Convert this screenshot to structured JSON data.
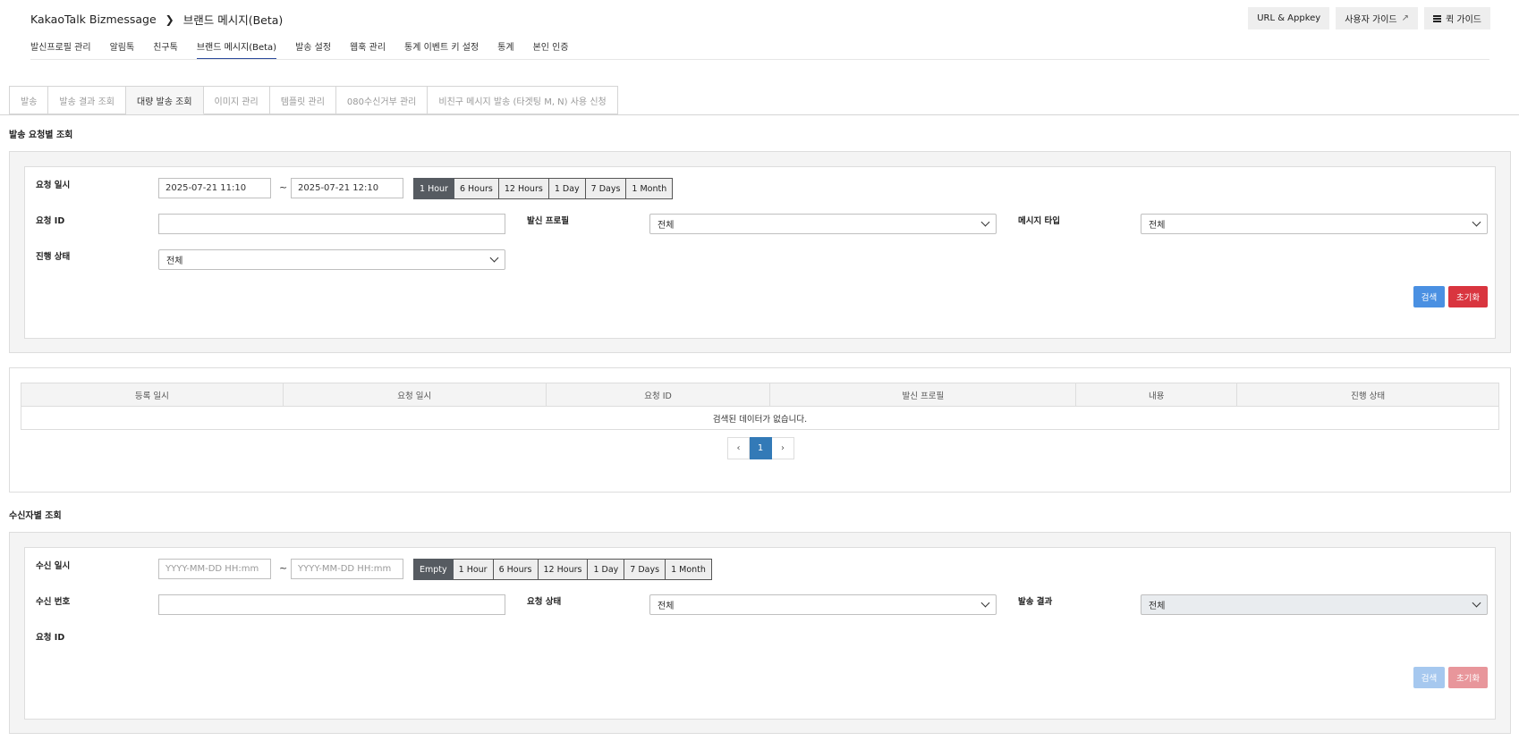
{
  "header": {
    "app_name": "KakaoTalk Bizmessage",
    "breadcrumb_sep": ">",
    "page_name": "브랜드 메시지(Beta)",
    "buttons": {
      "url_appkey": "URL & Appkey",
      "user_guide": "사용자 가이드",
      "quick_guide": "퀵 가이드"
    }
  },
  "nav": {
    "items": [
      "발신프로필 관리",
      "알림톡",
      "친구톡",
      "브랜드 메시지(Beta)",
      "발송 설정",
      "웹훅 관리",
      "통계 이벤트 키 설정",
      "통계",
      "본인 인증"
    ],
    "active_index": 3
  },
  "tabs": {
    "items": [
      "발송",
      "발송 결과 조회",
      "대량 발송 조회",
      "이미지 관리",
      "템플릿 관리",
      "080수신거부 관리",
      "비친구 메시지 발송 (타겟팅 M, N) 사용 신청"
    ],
    "active_index": 2
  },
  "request_section": {
    "title": "발송 요청별 조회",
    "fields": {
      "request_datetime_label": "요청 일시",
      "start": "2025-07-21 11:10",
      "tilde": "~",
      "end": "2025-07-21 12:10",
      "ranges": [
        "1 Hour",
        "6 Hours",
        "12 Hours",
        "1 Day",
        "7 Days",
        "1 Month"
      ],
      "active_range": "1 Hour",
      "request_id_label": "요청 ID",
      "request_id_value": "",
      "sender_profile_label": "발신 프로필",
      "sender_profile_value": "전체",
      "message_type_label": "메시지 타입",
      "message_type_value": "전체",
      "status_label": "진행 상태",
      "status_value": "전체"
    },
    "search_label": "검색",
    "reset_label": "초기화"
  },
  "results_table": {
    "columns": [
      "등록 일시",
      "요청 일시",
      "요청 ID",
      "발신 프로필",
      "내용",
      "진행 상태"
    ],
    "empty_message": "검색된 데이터가 없습니다.",
    "pager": {
      "prev": "‹",
      "current": "1",
      "next": "›"
    }
  },
  "recipient_section": {
    "title": "수신자별 조회",
    "fields": {
      "receive_datetime_label": "수신 일시",
      "start_placeholder": "YYYY-MM-DD HH:mm",
      "tilde": "~",
      "end_placeholder": "YYYY-MM-DD HH:mm",
      "ranges": [
        "Empty",
        "1 Hour",
        "6 Hours",
        "12 Hours",
        "1 Day",
        "7 Days",
        "1 Month"
      ],
      "active_range": "Empty",
      "recipient_number_label": "수신 번호",
      "recipient_number_value": "",
      "request_status_label": "요청 상태",
      "request_status_value": "전체",
      "send_result_label": "발송 결과",
      "send_result_value": "전체",
      "request_id_label": "요청 ID"
    },
    "search_label": "검색",
    "reset_label": "초기화"
  }
}
